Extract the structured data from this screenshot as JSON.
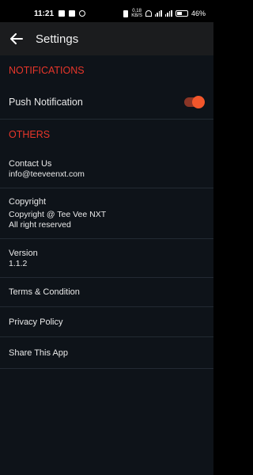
{
  "status_bar": {
    "time": "11:21",
    "net_speed": "0.18\nKB/S",
    "battery": "46%"
  },
  "header": {
    "title": "Settings"
  },
  "notifications": {
    "heading": "NOTIFICATIONS",
    "push_label": "Push Notification",
    "push_enabled": true
  },
  "others": {
    "heading": "OTHERS",
    "items": [
      {
        "title": "Contact Us",
        "lines": [
          "info@teeveenxt.com"
        ]
      },
      {
        "title": "Copyright",
        "lines": [
          "Copyright @ Tee Vee NXT",
          "All right reserved"
        ]
      },
      {
        "title": "Version",
        "lines": [
          "1.1.2"
        ]
      },
      {
        "title": "Terms & Condition",
        "lines": []
      },
      {
        "title": "Privacy Policy",
        "lines": []
      },
      {
        "title": "Share This App",
        "lines": []
      }
    ]
  },
  "colors": {
    "accent": "#e8362a",
    "toggle_knob": "#f2562b",
    "background": "#0e1319",
    "app_bar": "#1b1c1e"
  },
  "icons": {
    "back": "arrow-left-icon"
  }
}
